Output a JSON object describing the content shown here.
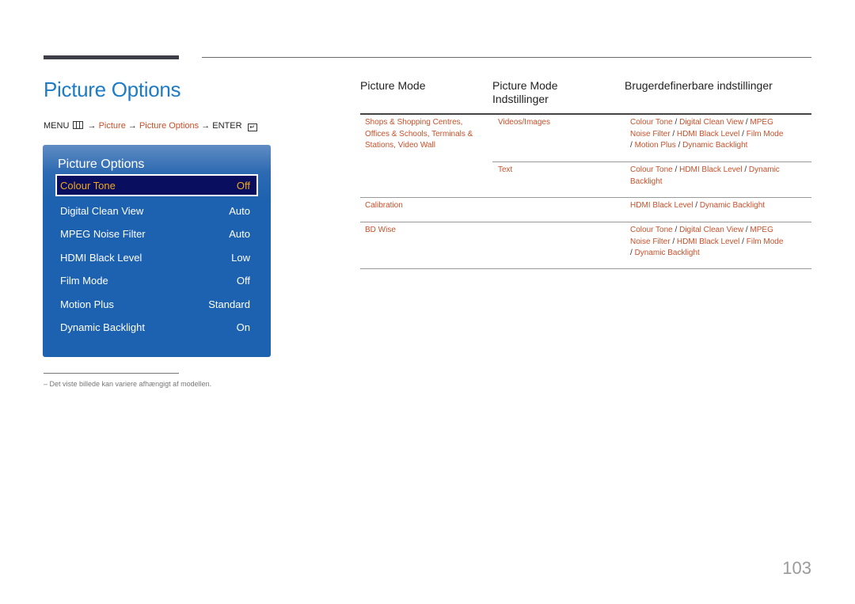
{
  "page": {
    "title": "Picture Options",
    "page_number": "103",
    "footnote": "–  Det viste billede kan variere afhængigt af modellen."
  },
  "menu_path": {
    "menu": "MENU",
    "menu_icon": "menu-grid-icon",
    "arrow": "→",
    "step1": "Picture",
    "step2": "Picture Options",
    "enter": "ENTER",
    "enter_icon": "enter-icon"
  },
  "osd": {
    "title": "Picture Options",
    "items": [
      {
        "label": "Colour Tone",
        "value": "Off",
        "selected": true
      },
      {
        "label": "Digital Clean View",
        "value": "Auto"
      },
      {
        "label": "MPEG Noise Filter",
        "value": "Auto"
      },
      {
        "label": "HDMI Black Level",
        "value": "Low"
      },
      {
        "label": "Film Mode",
        "value": "Off"
      },
      {
        "label": "Motion Plus",
        "value": "Standard"
      },
      {
        "label": "Dynamic Backlight",
        "value": "On"
      }
    ]
  },
  "table": {
    "headers": [
      "Picture Mode",
      "Picture Mode\nIndstillinger",
      "Brugerdefinerbare indstillinger"
    ],
    "header_col2_line1": "Picture Mode",
    "header_col2_line2": "Indstillinger",
    "rows": [
      {
        "mode": "Shops & Shopping Centres, Offices & Schools, Terminals & Stations, Video Wall",
        "mode_lines": [
          "Shops & Shopping Centres,",
          "Offices & Schools, Terminals &",
          "Stations, Video Wall"
        ],
        "setting": "Videos/Images",
        "custom_lines": [
          [
            "Colour Tone",
            "Digital Clean View",
            "MPEG"
          ],
          [
            "Noise Filter",
            "HDMI Black Level",
            "Film Mode"
          ],
          [
            "",
            "Motion Plus",
            "Dynamic Backlight"
          ]
        ]
      },
      {
        "mode": "",
        "setting": "Text",
        "custom_lines": [
          [
            "Colour Tone",
            "HDMI Black Level",
            "Dynamic"
          ],
          [
            "Backlight"
          ]
        ]
      },
      {
        "mode": "Calibration",
        "setting": "",
        "custom_lines": [
          [
            "HDMI Black Level",
            "Dynamic Backlight"
          ]
        ]
      },
      {
        "mode": "BD Wise",
        "setting": "",
        "custom_lines": [
          [
            "Colour Tone",
            "Digital Clean View",
            "MPEG"
          ],
          [
            "Noise Filter",
            "HDMI Black Level",
            "Film Mode"
          ],
          [
            "",
            "Dynamic Backlight"
          ]
        ]
      }
    ]
  },
  "colors": {
    "accent_blue": "#1e7bc6",
    "link_red": "#c8502a",
    "osd_bg": "#1d62b0",
    "osd_selected_bg": "#0a0e5f",
    "osd_selected_text": "#f0a81e"
  }
}
